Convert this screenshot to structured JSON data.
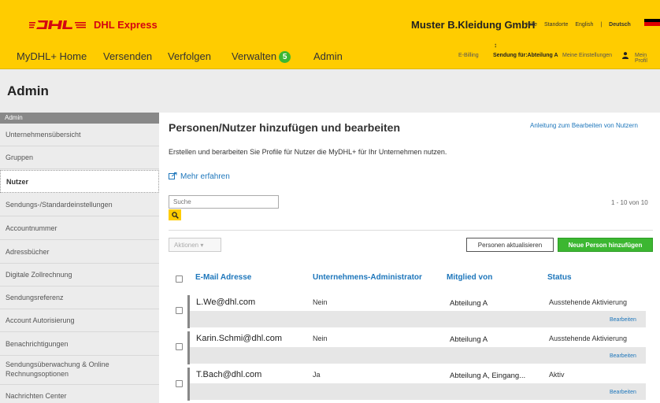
{
  "header": {
    "brand_label": "DHL Express",
    "company": "Muster B.Kleidung GmbH",
    "util_links": [
      "Hilfe",
      "Standorte",
      "English",
      "Deutsch"
    ],
    "nav": [
      "MyDHL+ Home",
      "Versenden",
      "Verfolgen",
      "Verwalten",
      "Admin"
    ],
    "manage_badge": "5",
    "sub_billing": "E-Billing",
    "sub_shipping_for": "Sendung für:Abteilung A",
    "sub_settings": "Meine Einstellungen",
    "sub_profile": "Mein Profil",
    "brand_color": "#FFCC00",
    "accent_color": "#D40511"
  },
  "page": {
    "title": "Admin"
  },
  "sidebar": {
    "header": "Admin",
    "items": [
      "Unternehmensübersicht",
      "Gruppen",
      "Nutzer",
      "Sendungs-/Standardeinstellungen",
      "Accountnummer",
      "Adressbücher",
      "Digitale Zollrechnung",
      "Sendungsreferenz",
      "Account Autorisierung",
      "Benachrichtigungen",
      "Sendungsüberwachung & Online Rechnungsoptionen",
      "Nachrichten Center"
    ],
    "active_item": "Nutzer"
  },
  "main": {
    "title": "Personen/Nutzer hinzufügen und bearbeiten",
    "help_link": "Anleitung zum Bearbeiten von Nutzern",
    "description": "Erstellen und berarbeiten Sie Profile für Nutzer die MyDHL+ für Ihr Unternehmen nutzen.",
    "learn_more": "Mehr erfahren",
    "search_placeholder": "Suche",
    "result_count": "1 - 10 von 10",
    "actions_label": "Aktionen ▾",
    "refresh_label": "Personen aktualisieren",
    "add_label": "Neue Person hinzufügen"
  },
  "table": {
    "headers": [
      "E-Mail Adresse",
      "Unternehmens-Administrator",
      "Mitglied von",
      "Status"
    ],
    "rows": [
      {
        "email": "L.We@dhl.com",
        "admin": "Nein",
        "group": "Abteilung A",
        "status": "Ausstehende Aktivierung",
        "action": "Bearbeiten"
      },
      {
        "email": "Karin.Schmi@dhl.com",
        "admin": "Nein",
        "group": "Abteilung A",
        "status": "Ausstehende Aktivierung",
        "action": "Bearbeiten"
      },
      {
        "email": "T.Bach@dhl.com",
        "admin": "Ja",
        "group": "Abteilung A, Eingang...",
        "status": "Aktiv",
        "action": "Bearbeiten"
      }
    ]
  }
}
